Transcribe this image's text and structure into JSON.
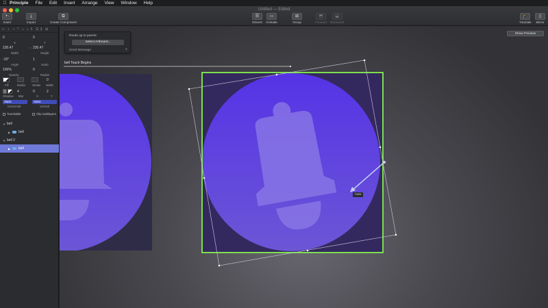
{
  "menubar": {
    "app": "Principle",
    "items": [
      "File",
      "Edit",
      "Insert",
      "Arrange",
      "View",
      "Window",
      "Help"
    ]
  },
  "window": {
    "title": "Untitled — Edited"
  },
  "toolbar": {
    "insert": "Insert",
    "import": "Import",
    "create_component": "Create Component",
    "drivers": "Drivers",
    "animate": "Animate",
    "group": "Group",
    "forward": "Forward",
    "backward": "Backward",
    "tutorials": "Tutorials",
    "mirror": "Mirror"
  },
  "inspector": {
    "x": "0",
    "x_label": "X",
    "y": "0",
    "y_label": "Y",
    "width": "230.47",
    "width_label": "Width",
    "height": "230.47",
    "height_label": "Height",
    "angle": "-10°",
    "angle_label": "Angle",
    "scale": "1",
    "scale_label": "Scale",
    "opacity": "100%",
    "opacity_label": "Opacity",
    "radius": "0",
    "radius_label": "Radius",
    "fill_label": "Fill",
    "media_label": "Media",
    "stroke": "0",
    "stroke_label": "Stroke",
    "stroke_width_label": "Width",
    "shadow_label": "Shadow",
    "blur": "4",
    "blur_label": "Blur",
    "shadow_x": "0",
    "shadow_x_label": "X",
    "shadow_y": "2",
    "shadow_y_label": "Y",
    "horizontal": "Static",
    "horizontal_label": "Horizontal",
    "vertical": "Static",
    "vertical_label": "Vertical",
    "touchable": "Touchable",
    "clip_sublayers": "Clip Sublayers"
  },
  "layers": [
    {
      "name": "bell",
      "level": 0
    },
    {
      "name": "bell",
      "level": 1
    },
    {
      "name": "bell 2",
      "level": 0
    },
    {
      "name": "bell",
      "level": 1,
      "selected": true
    }
  ],
  "canvas": {
    "preview_button": "Show Preview",
    "popover_route": "Route up to parent",
    "popover_select": "Select Artboard...",
    "popover_send": "Send Message",
    "event_label": "bell Touch Begins",
    "auto_badge": "Auto"
  },
  "colors": {
    "accent": "#6f79d8",
    "selection_green": "#7ee04f",
    "circle_top": "#5a3be4",
    "circle_bottom": "#6a52d8"
  }
}
